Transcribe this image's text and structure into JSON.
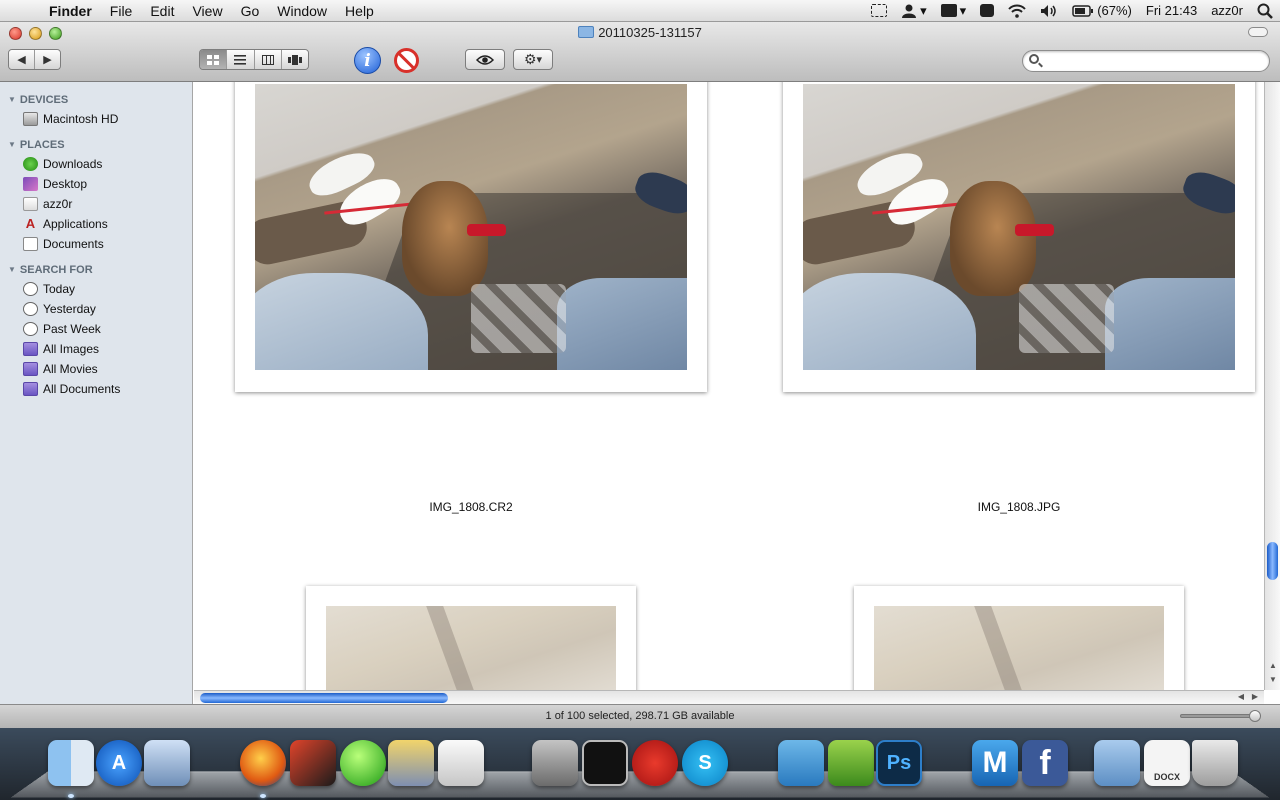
{
  "menubar": {
    "app_name": "Finder",
    "items": [
      "File",
      "Edit",
      "View",
      "Go",
      "Window",
      "Help"
    ],
    "battery": "(67%)",
    "clock": "Fri 21:43",
    "user": "azz0r"
  },
  "window": {
    "title": "20110325-131157",
    "status": "1 of 100 selected, 298.71 GB available"
  },
  "sidebar": {
    "devices_header": "DEVICES",
    "devices": [
      {
        "label": "Macintosh HD"
      }
    ],
    "places_header": "PLACES",
    "places": [
      {
        "label": "Downloads"
      },
      {
        "label": "Desktop"
      },
      {
        "label": "azz0r"
      },
      {
        "label": "Applications"
      },
      {
        "label": "Documents"
      }
    ],
    "search_header": "SEARCH FOR",
    "search": [
      {
        "label": "Today"
      },
      {
        "label": "Yesterday"
      },
      {
        "label": "Past Week"
      },
      {
        "label": "All Images"
      },
      {
        "label": "All Movies"
      },
      {
        "label": "All Documents"
      }
    ]
  },
  "files": [
    {
      "name": "IMG_1808.CR2"
    },
    {
      "name": "IMG_1808.JPG"
    }
  ],
  "dock": {
    "items": [
      "finder-icon",
      "app-store-icon",
      "preview-icon",
      "firefox-icon",
      "virtualbox-icon",
      "green-ball-icon",
      "transmit-icon",
      "utilities-icon",
      "system-preferences-icon",
      "terminal-icon",
      "tomato-icon",
      "skype-icon",
      "wunderlist-icon",
      "nodes-icon",
      "photoshop-icon",
      "m-app-icon",
      "facebook-icon",
      "applications-folder-icon",
      "docx-icon",
      "trash-icon"
    ],
    "photoshop_label": "Ps",
    "m_label": "M",
    "facebook_label": "f",
    "docx_label": "DOCX"
  }
}
